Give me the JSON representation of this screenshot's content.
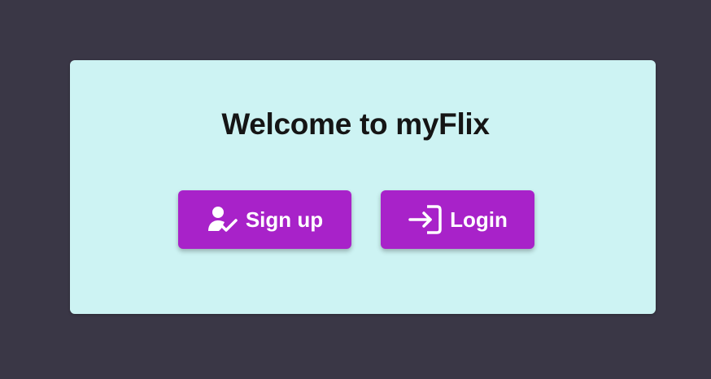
{
  "colors": {
    "page_background": "#3a3746",
    "card_background": "#cdf3f3",
    "button_background": "#a822c9",
    "button_text": "#ffffff",
    "title_text": "#151515"
  },
  "welcome": {
    "title": "Welcome to myFlix"
  },
  "actions": {
    "signup": {
      "label": "Sign up",
      "icon": "person-check-icon"
    },
    "login": {
      "label": "Login",
      "icon": "login-icon"
    }
  }
}
